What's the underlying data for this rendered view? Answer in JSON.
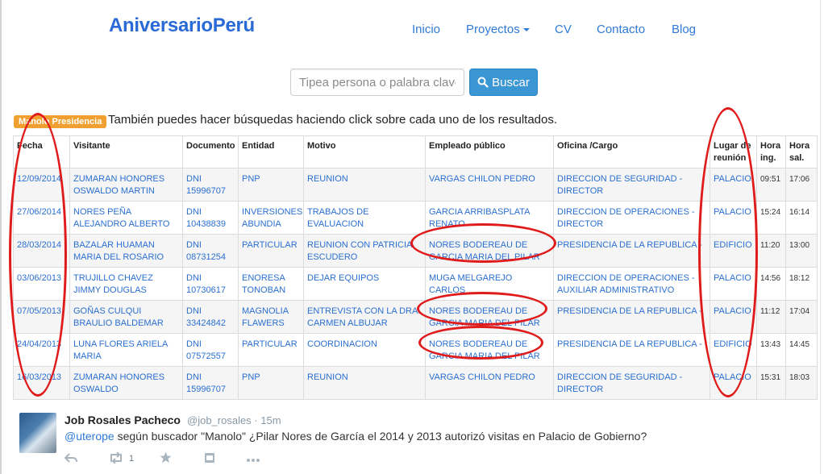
{
  "brand": "AniversarioPerú",
  "nav": {
    "inicio": "Inicio",
    "proyectos": "Proyectos",
    "cv": "CV",
    "contacto": "Contacto",
    "blog": "Blog"
  },
  "search": {
    "placeholder": "Tipea persona o palabra clave",
    "button": "Buscar"
  },
  "badge": "Manolo Presidencia",
  "hint": "También puedes hacer búsquedas haciendo click sobre cada uno de los resultados.",
  "table": {
    "headers": [
      "Fecha",
      "Visitante",
      "Documento",
      "Entidad",
      "Motivo",
      "Empleado público",
      "Oficina /Cargo",
      "Lugar de reunión",
      "Hora ing.",
      "Hora sal."
    ],
    "rows": [
      [
        "12/09/2014",
        "ZUMARAN HONORES OSWALDO MARTIN",
        "DNI 15996707",
        "PNP",
        "REUNION",
        "VARGAS CHILON PEDRO",
        "DIRECCION DE SEGURIDAD - DIRECTOR",
        "PALACIO",
        "09:51",
        "17:06"
      ],
      [
        "27/06/2014",
        "NORES PEÑA ALEJANDRO ALBERTO",
        "DNI 10438839",
        "INVERSIONES ABUNDIA",
        "TRABAJOS DE EVALUACION",
        "GARCIA ARRIBASPLATA RENATO",
        "DIRECCION DE OPERACIONES - DIRECTOR",
        "PALACIO",
        "15:24",
        "16:14"
      ],
      [
        "28/03/2014",
        "BAZALAR HUAMAN MARIA DEL ROSARIO",
        "DNI 08731254",
        "PARTICULAR",
        "REUNION CON PATRICIA ESCUDERO",
        "NORES BODEREAU DE GARCIA MARIA DEL PILAR",
        "PRESIDENCIA DE LA REPUBLICA -",
        "EDIFICIO",
        "11:20",
        "13:00"
      ],
      [
        "03/06/2013",
        "TRUJILLO CHAVEZ JIMMY DOUGLAS",
        "DNI 10730617",
        "ENORESA TONOBAN",
        "DEJAR EQUIPOS",
        "MUGA MELGAREJO CARLOS",
        "DIRECCION DE OPERACIONES - AUXILIAR ADMINISTRATIVO",
        "PALACIO",
        "14:56",
        "18:12"
      ],
      [
        "07/05/2013",
        "GOÑAS CULQUI BRAULIO BALDEMAR",
        "DNI 33424842",
        "MAGNOLIA FLAWERS",
        "ENTREVISTA CON LA DRA. CARMEN ALBUJAR",
        "NORES BODEREAU DE GARCIA MARIA DEL PILAR",
        "PRESIDENCIA DE LA REPUBLICA -",
        "PALACIO",
        "11:12",
        "17:04"
      ],
      [
        "24/04/2013",
        "LUNA FLORES ARIELA MARIA",
        "DNI 07572557",
        "PARTICULAR",
        "COORDINACION",
        "NORES BODEREAU DE GARCIA MARIA DEL PILAR",
        "PRESIDENCIA DE LA REPUBLICA -",
        "EDIFICIO",
        "13:43",
        "14:45"
      ],
      [
        "16/03/2013",
        "ZUMARAN HONORES OSWALDO",
        "DNI 15996707",
        "PNP",
        "REUNION",
        "VARGAS CHILON PEDRO",
        "DIRECCION DE SEGURIDAD - DIRECTOR",
        "PALACIO",
        "15:31",
        "18:03"
      ]
    ]
  },
  "tweet": {
    "name": "Job Rosales Pacheco",
    "handle": "@job_rosales · 15m",
    "mention": "@uterope",
    "text": " según buscador \"Manolo\" ¿Pilar Nores de García el 2014 y 2013 autorizó visitas en Palacio de Gobierno?",
    "retweets": "1"
  },
  "colors": {
    "brand": "#2a6ad6",
    "link": "#2f7ad8",
    "button": "#3b96d4",
    "badge": "#f0a030",
    "annotation": "#e01b1b"
  }
}
